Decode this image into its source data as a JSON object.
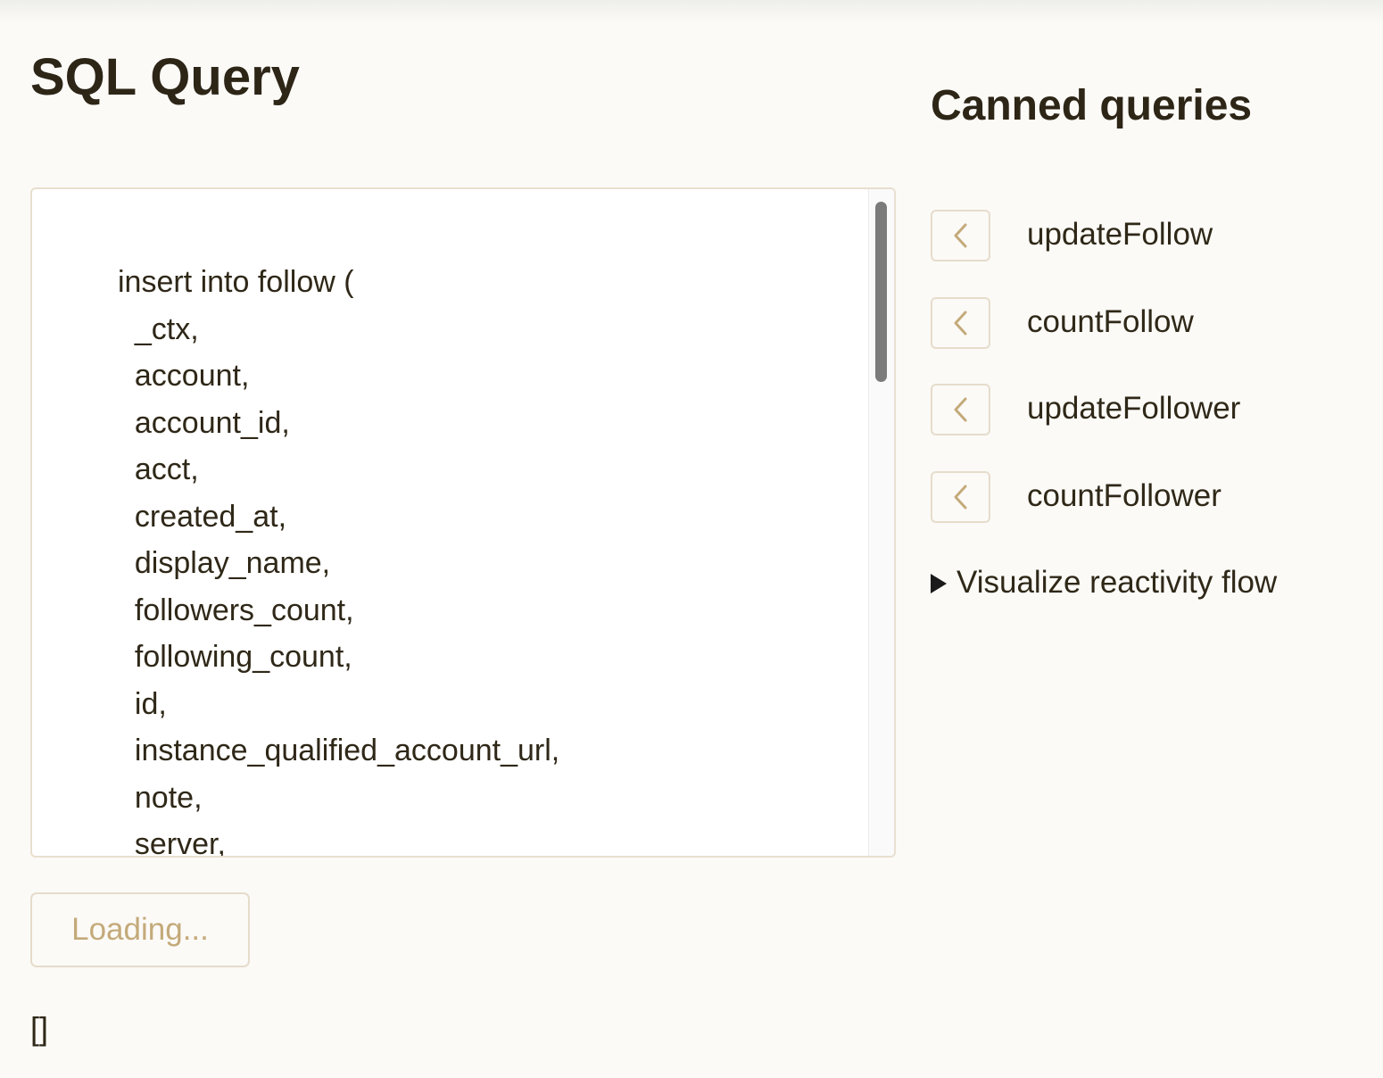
{
  "page": {
    "title": "SQL Query"
  },
  "editor": {
    "code": "insert into follow (\n  _ctx,\n  account,\n  account_id,\n  acct,\n  created_at,\n  display_name,\n  followers_count,\n  following_count,\n  id,\n  instance_qualified_account_url,\n  note,\n  server,"
  },
  "run_button": {
    "label": "Loading..."
  },
  "result": {
    "text": "[]"
  },
  "sidebar": {
    "title": "Canned queries",
    "queries": [
      {
        "name": "updateFollow",
        "icon": "chevron-left-icon"
      },
      {
        "name": "countFollow",
        "icon": "chevron-left-icon"
      },
      {
        "name": "updateFollower",
        "icon": "chevron-left-icon"
      },
      {
        "name": "countFollower",
        "icon": "chevron-left-icon"
      }
    ],
    "visualize": {
      "label": "Visualize reactivity flow",
      "icon": "disclosure-triangle-icon"
    }
  },
  "colors": {
    "background": "#fbfaf7",
    "text": "#2f2818",
    "accent": "#c4aa7a",
    "border": "#e6dccb"
  }
}
